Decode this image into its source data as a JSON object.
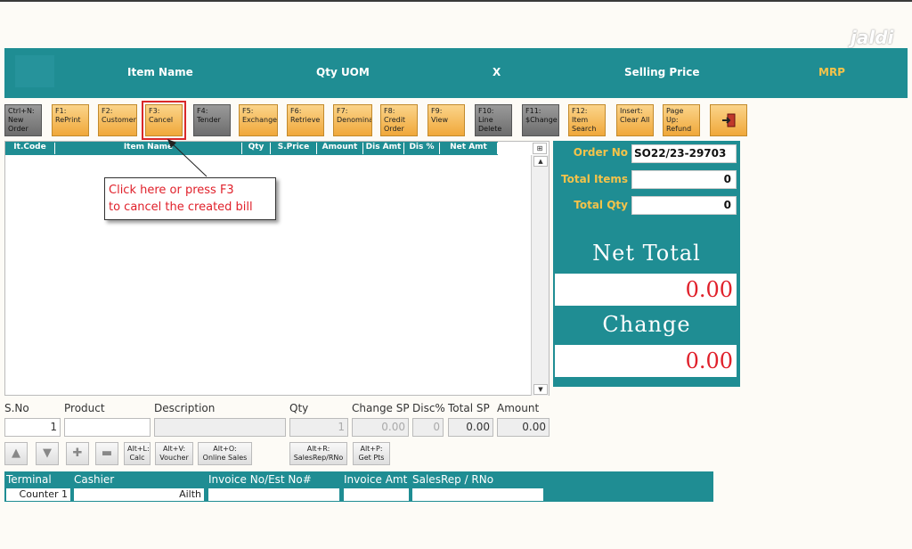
{
  "watermark": "jaldi",
  "header": {
    "item_name": "Item Name",
    "qty_uom": "Qty UOM",
    "x": "X",
    "selling_price": "Selling Price",
    "mrp": "MRP"
  },
  "toolbar": [
    {
      "text": "Ctrl+N:\nNew\nOrder",
      "style": "grey"
    },
    {
      "text": "F1:\nRePrint",
      "style": "orange"
    },
    {
      "text": "F2:\nCustomer",
      "style": "orange"
    },
    {
      "text": "F3:\nCancel",
      "style": "orange"
    },
    {
      "text": "F4:\nTender",
      "style": "grey"
    },
    {
      "text": "F5:\nExchange",
      "style": "orange"
    },
    {
      "text": "F6:\nRetrieve",
      "style": "orange"
    },
    {
      "text": "F7:\nDenomina",
      "style": "orange"
    },
    {
      "text": "F8:\nCredit\nOrder",
      "style": "orange"
    },
    {
      "text": "F9:\nView",
      "style": "orange"
    },
    {
      "text": "F10:\nLine\nDelete",
      "style": "grey"
    },
    {
      "text": "F11:\n$Change",
      "style": "grey"
    },
    {
      "text": "F12:\nItem\nSearch",
      "style": "orange"
    },
    {
      "text": "Insert:\nClear All",
      "style": "orange"
    },
    {
      "text": "Page Up:\nRefund",
      "style": "orange"
    }
  ],
  "icons": {
    "exit": "exit-door-icon",
    "grid_corner": "grid-settings-icon",
    "scroll_up": "scroll-up-icon",
    "scroll_down": "scroll-down-icon",
    "move_up": "arrow-up-icon",
    "move_down": "arrow-down-icon",
    "add": "plus-icon",
    "remove": "minus-icon"
  },
  "grid": {
    "columns": [
      "It.Code",
      "Item Name",
      "Qty",
      "S.Price",
      "Amount",
      "Dis Amt",
      "Dis %",
      "Net Amt"
    ]
  },
  "callout": {
    "line1": "Click here or press F3",
    "line2": "to cancel the created bill"
  },
  "summary": {
    "order_no_label": "Order No",
    "order_no": "SO22/23-29703",
    "total_items_label": "Total Items",
    "total_items": "0",
    "total_qty_label": "Total Qty",
    "total_qty": "0",
    "net_total_label": "Net Total",
    "net_total": "0.00",
    "change_label": "Change",
    "change": "0.00"
  },
  "entry": {
    "sno_label": "S.No",
    "product_label": "Product",
    "description_label": "Description",
    "qty_label": "Qty",
    "change_sp_label": "Change SP",
    "disc_label": "Disc%",
    "total_sp_label": "Total SP",
    "amount_label": "Amount",
    "sno": "1",
    "product": "",
    "description": "",
    "qty": "1",
    "change_sp": "0.00",
    "disc": "0",
    "total_sp": "0.00",
    "amount": "0.00"
  },
  "small_buttons": {
    "calc": "Alt+L:\nCalc",
    "voucher": "Alt+V:\nVoucher",
    "online_sales": "Alt+O:\nOnline Sales",
    "salesrep": "Alt+R:\nSalesRep/RNo",
    "get_pts": "Alt+P:\nGet Pts"
  },
  "footer": {
    "terminal_label": "Terminal",
    "cashier_label": "Cashier",
    "invoice_no_label": "Invoice No/Est No#",
    "invoice_amt_label": "Invoice Amt",
    "salesrep_label": "SalesRep / RNo",
    "terminal": "Counter 1",
    "cashier": "Ailth",
    "invoice_no": "",
    "invoice_amt": "",
    "salesrep": ""
  },
  "colors": {
    "teal": "#1f8d93",
    "orange": "#f0a83a",
    "red": "#e0202a",
    "gold": "#f4c34a"
  }
}
